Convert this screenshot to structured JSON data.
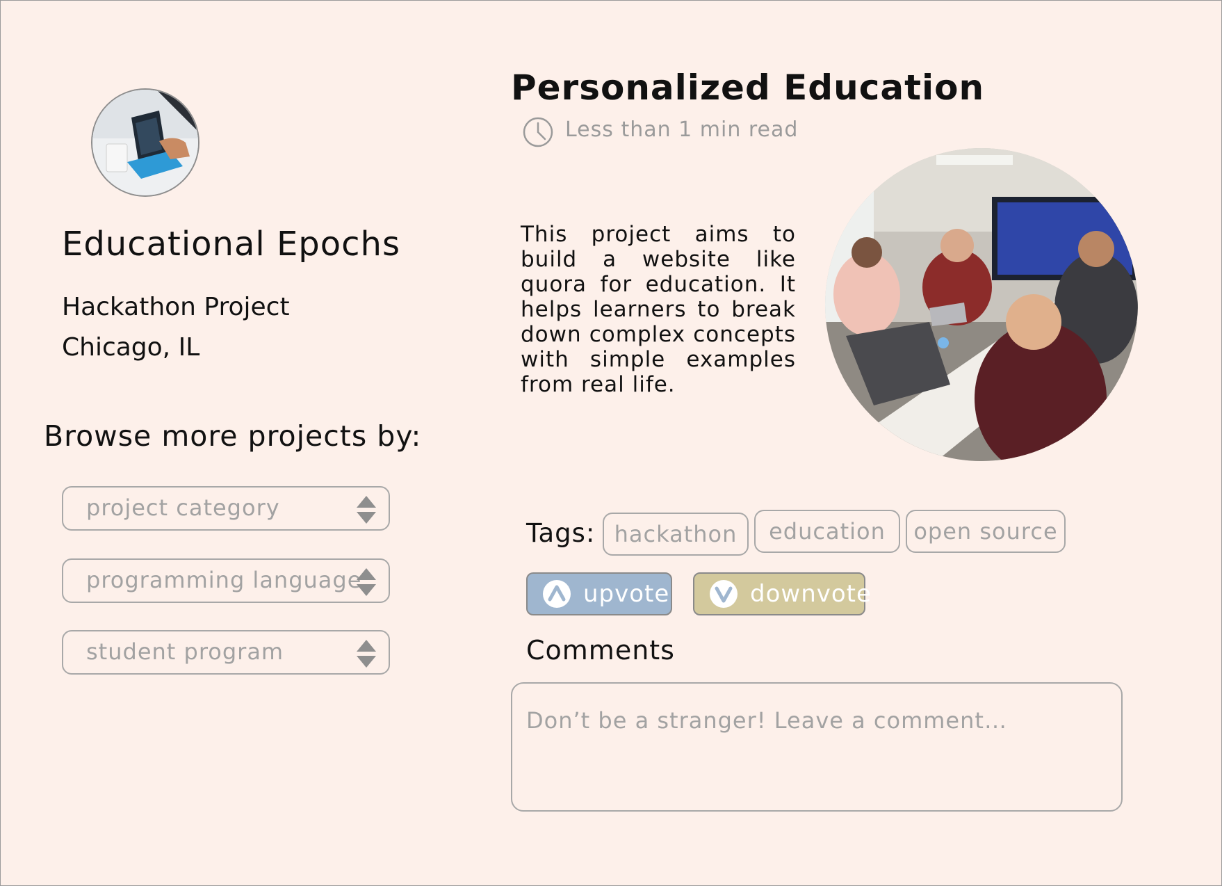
{
  "organization": {
    "name": "Educational Epochs",
    "type": "Hackathon Project",
    "location": "Chicago, IL"
  },
  "browse": {
    "heading": "Browse more projects by:",
    "filters": [
      {
        "label": "project category"
      },
      {
        "label": "programming language"
      },
      {
        "label": "student program"
      }
    ]
  },
  "post": {
    "title": "Personalized Education",
    "read_time": "Less than 1 min read",
    "description": "This project aims to build a website like quora for education. It helps learners to break down complex concepts with simple examples from real life."
  },
  "tags": {
    "label": "Tags:",
    "items": [
      "hackathon",
      "education",
      "open source"
    ]
  },
  "votes": {
    "upvote_label": "upvote",
    "downvote_label": "downvote",
    "upvote_color": "#9fb6cf",
    "downvote_color": "#d3c99d"
  },
  "comments": {
    "heading": "Comments",
    "placeholder": "Don’t be a stranger! Leave a comment…"
  },
  "icons": {
    "avatar": "laptop-photo",
    "read_time": "clock-icon",
    "filter": "spinner-arrows-icon",
    "upvote": "upvote-chevron-icon",
    "downvote": "downvote-chevron-icon"
  },
  "colors": {
    "background": "#fdf0ea",
    "border": "#a8a8a8",
    "muted_text": "#a2a2a2"
  }
}
